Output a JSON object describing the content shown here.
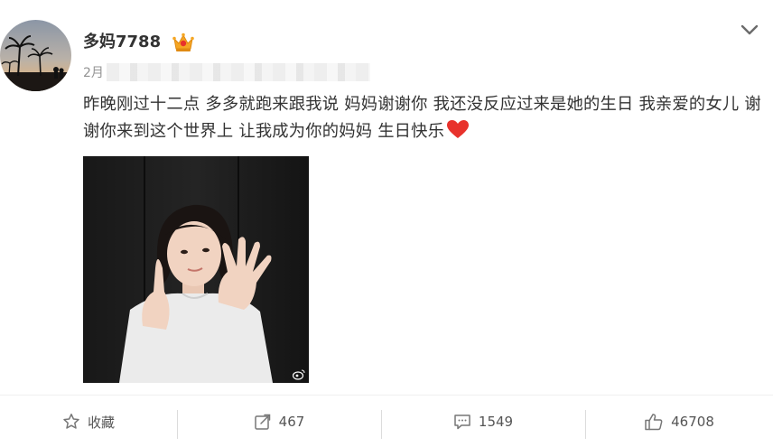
{
  "post": {
    "author": "多妈7788",
    "timestamp_prefix": "2月",
    "text": "昨晚刚过十二点 多多就跑来跟我说 妈妈谢谢你 我还没反应过来是她的生日 我亲爱的女儿 谢谢你来到这个世界上 让我成为你的妈妈 生日快乐"
  },
  "footer": {
    "favorite_label": "收藏",
    "repost_count": "467",
    "comment_count": "1549",
    "like_count": "46708"
  },
  "icons": {
    "avatar": "avatar-palm-sunset",
    "badge": "crown-icon",
    "menu": "chevron-down-icon",
    "emoji": "heart-icon",
    "favorite": "star-icon",
    "repost": "repost-icon",
    "comment": "comment-icon",
    "like": "thumbs-up-icon"
  },
  "colors": {
    "text": "#333333",
    "muted": "#939393",
    "heart": "#e8322c",
    "crown": "#f5a623"
  }
}
